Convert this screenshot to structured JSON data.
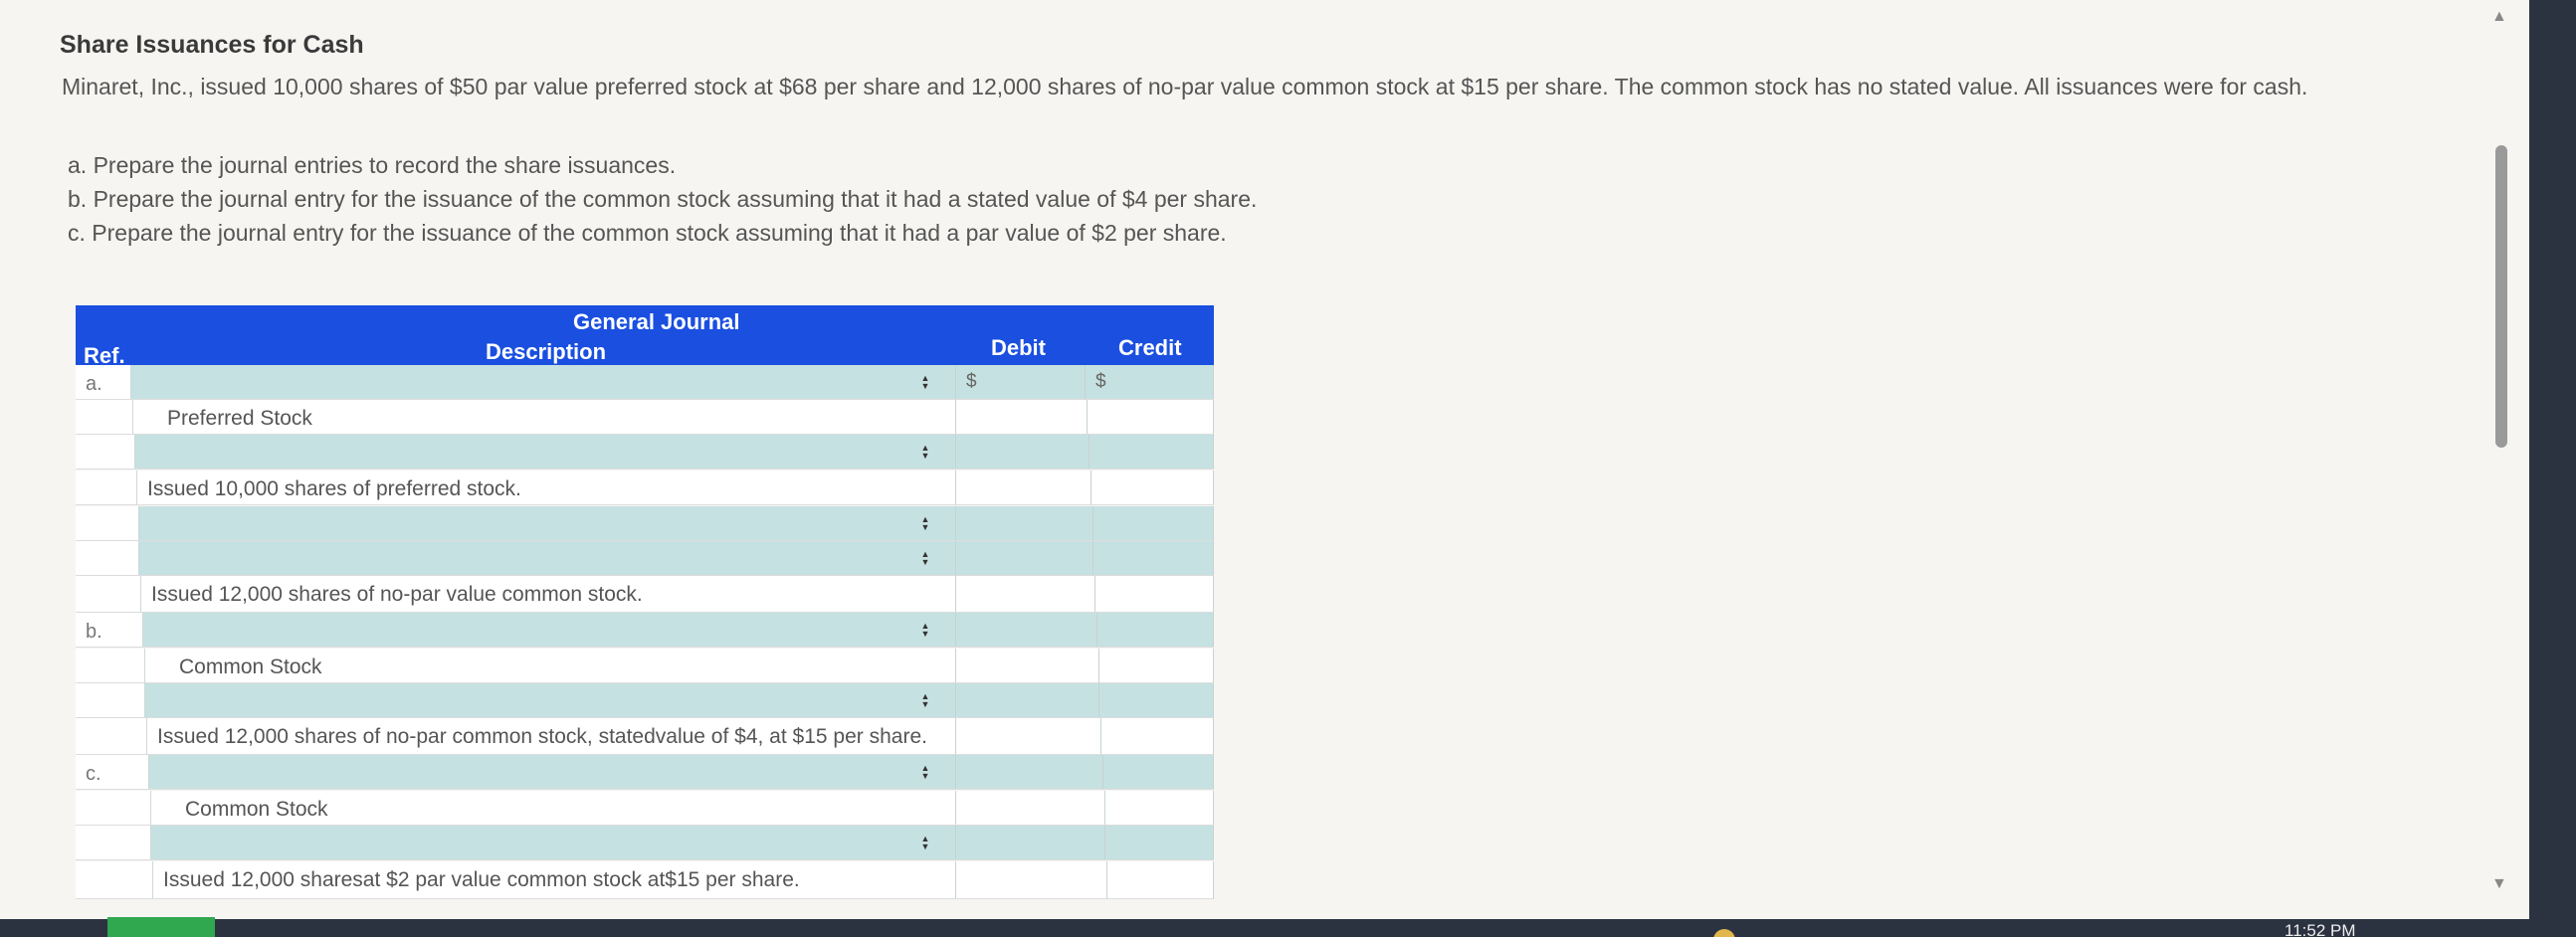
{
  "title": "Share Issuances for Cash",
  "intro": "Minaret, Inc., issued 10,000 shares of $50 par value preferred stock at $68 per share and 12,000 shares of no-par value common stock at $15 per share. The common stock has no stated value. All issuances were for cash.",
  "instructions": [
    "a. Prepare the journal entries to record the share issuances.",
    "b. Prepare the journal entry for the issuance of the common stock assuming that it had a stated value of $4 per share.",
    "c. Prepare the journal entry for the issuance of the common stock assuming that it had a par value of $2 per share."
  ],
  "journal": {
    "title": "General Journal",
    "col_ref": "Ref.",
    "col_description": "Description",
    "col_debit": "Debit",
    "col_credit": "Credit",
    "currency": "$",
    "rows": [
      {
        "ref": "a.",
        "description": "",
        "kind": "select"
      },
      {
        "ref": "",
        "description": "Preferred Stock",
        "kind": "text"
      },
      {
        "ref": "",
        "description": "",
        "kind": "select"
      },
      {
        "ref": "",
        "description": "Issued 10,000 shares of preferred stock.",
        "kind": "text"
      },
      {
        "ref": "",
        "description": "",
        "kind": "select"
      },
      {
        "ref": "",
        "description": "",
        "kind": "select"
      },
      {
        "ref": "",
        "description": "Issued 12,000 shares of no-par value common stock.",
        "kind": "text"
      },
      {
        "ref": "b.",
        "description": "",
        "kind": "select"
      },
      {
        "ref": "",
        "description": "Common Stock",
        "kind": "text"
      },
      {
        "ref": "",
        "description": "",
        "kind": "select"
      },
      {
        "ref": "",
        "description": "Issued 12,000 shares of no-par common stock, statedvalue of $4, at $15 per share.",
        "kind": "text"
      },
      {
        "ref": "c.",
        "description": "",
        "kind": "select"
      },
      {
        "ref": "",
        "description": "Common Stock",
        "kind": "text"
      },
      {
        "ref": "",
        "description": "",
        "kind": "select"
      },
      {
        "ref": "",
        "description": "Issued 12,000 sharesat $2 par value common stock at$15 per share.",
        "kind": "text"
      }
    ]
  },
  "clock": "11:52 PM",
  "icons": {
    "select_arrows": "up-down-arrows-icon",
    "scroll_up": "triangle-up-icon",
    "scroll_down": "triangle-down-icon"
  }
}
